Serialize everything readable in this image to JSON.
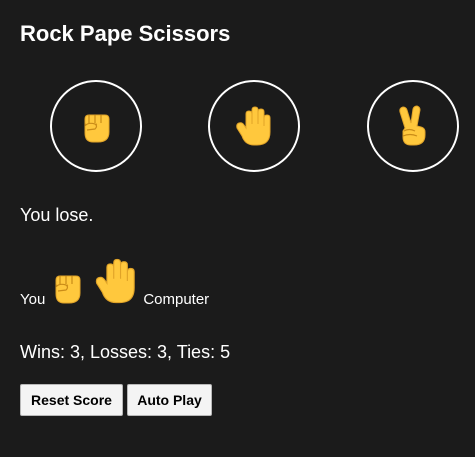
{
  "title": "Rock Pape Scissors",
  "moves": [
    {
      "name": "rock",
      "icon": "raised-fist-icon"
    },
    {
      "name": "paper",
      "icon": "raised-hand-icon"
    },
    {
      "name": "scissors",
      "icon": "victory-hand-icon"
    }
  ],
  "result": "You lose.",
  "last_round": {
    "player_label": "You",
    "player_move": "rock",
    "computer_move": "paper",
    "computer_label": "Computer"
  },
  "score_text": "Wins: 3, Losses: 3, Ties: 5",
  "buttons": {
    "reset": "Reset Score",
    "auto_play": "Auto Play"
  },
  "colors": {
    "background": "#1b1b1b",
    "text": "#ffffff",
    "emoji_skin": "#ffc83d"
  }
}
